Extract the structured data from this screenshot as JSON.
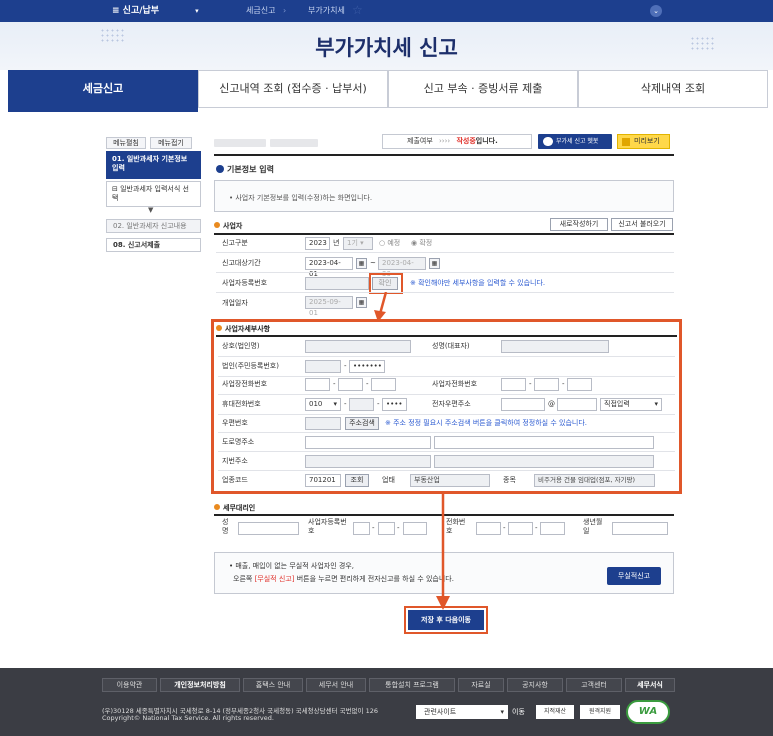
{
  "topnav": {
    "menu": "≡ 신고/납부",
    "dropdown": "▾",
    "crumb1": "세금신고",
    "crumb2": "부가가치세",
    "chevron": "⌄"
  },
  "banner": {
    "title": "부가가치세 신고"
  },
  "tabs": [
    {
      "label": "세금신고"
    },
    {
      "label": "신고내역 조회 (접수증 · 납부서)"
    },
    {
      "label": "신고 부속 · 증빙서류 제출"
    },
    {
      "label": "삭제내역 조회"
    }
  ],
  "leftnav": {
    "expand": "메뉴펼침",
    "collapse": "메뉴접기",
    "step1": "01. 일반과세자 기본정보 입력",
    "step1_sub": "일반과세자 입력서식 선택",
    "step2": "02. 일반과세자 신고내용",
    "step8": "08. 신고서제출"
  },
  "status": {
    "submit_label": "제출여부",
    "arrows": "››››",
    "writing": "작성중",
    "writing_suffix": "입니다.",
    "help_btn": "부가세 신고 헷봇",
    "preview_btn": "미리보기"
  },
  "basic": {
    "title": "기본정보 입력",
    "notice": "• 사업자 기본정보를 입력(수정)하는 화면입니다."
  },
  "biz": {
    "title": "사업자",
    "new_btn": "새로작성하기",
    "load_btn": "신고서 불러오기",
    "period_label": "신고구분",
    "year": "2023",
    "year_unit": "년",
    "term": "1기",
    "opt1": "예정",
    "opt2": "확정",
    "range_label": "신고대상기간",
    "from": "2023-04-01",
    "to": "2023-04-30",
    "tilde": "~",
    "regno_label": "사업자등록번호",
    "confirm_btn": "확인",
    "regno_hint": "※ 확인해야만 세부사항을 입력할 수 있습니다.",
    "open_label": "개업일자",
    "open_date": "2025-09-01"
  },
  "detail": {
    "title": "사업자세부사항",
    "name_label": "상호(법인명)",
    "rep_label": "성명(대표자)",
    "corpno_label": "법인(주민등록번호)",
    "masked": "•••••••",
    "biz_tel_label": "사업장전화번호",
    "home_tel_label": "사업자전화번호",
    "mobile_label": "휴대전화번호",
    "mobile_prefix": "010",
    "mobile_tail": "••••",
    "email_label": "전자우편주소",
    "at": "@",
    "email_sel": "직접입력",
    "zip_label": "우편번호",
    "zip_btn": "주소검색",
    "zip_hint": "※ 주소 정정 필요시 주소검색 버튼을 클릭하여 정정하실 수 있습니다.",
    "road_label": "도로명주소",
    "jibun_label": "지번주소",
    "code_label": "업종코드",
    "code": "701201",
    "lookup_btn": "조회",
    "type_label": "업태",
    "type": "부동산업",
    "kind_label": "종목",
    "kind": "비주거용 건물 임대업(점포, 자기땅)"
  },
  "agent": {
    "title": "세무대리인",
    "name_label": "성명",
    "reg_label": "사업자등록번호",
    "tel_label": "전화번호",
    "birth_label": "생년월일"
  },
  "nullrep": {
    "line1": "• 매출, 매입이 없는 무실적 사업자인 경우,",
    "line2_pre": "오른쪽",
    "line2_em": "[무실적 신고]",
    "line2_post": "버튼을 누르면 편리하게 전자신고를 하실 수 있습니다.",
    "btn": "무실적신고"
  },
  "save_btn": "저장 후 다음이동",
  "footer": {
    "links": [
      "이용약관",
      "개인정보처리방침",
      "홈택스 안내",
      "세무서 안내",
      "통합설치 프로그램",
      "자료실",
      "공지사항",
      "고객센터",
      "세무서식"
    ],
    "address": "(우)30128 세종특별자치시 국세청로 8-14 (정부세종2청사 국세청동) 국세청상담센터 국번없이 126",
    "copyright": "Copyright© National Tax Service. All rights reserved.",
    "related": "관련사이트",
    "move": "이동",
    "badge1": "지적재산",
    "badge2": "원격지원",
    "wa": "WA"
  },
  "colors": {
    "navy": "#1d3f8e",
    "orange": "#e0572a",
    "footer": "#3b3d44"
  }
}
